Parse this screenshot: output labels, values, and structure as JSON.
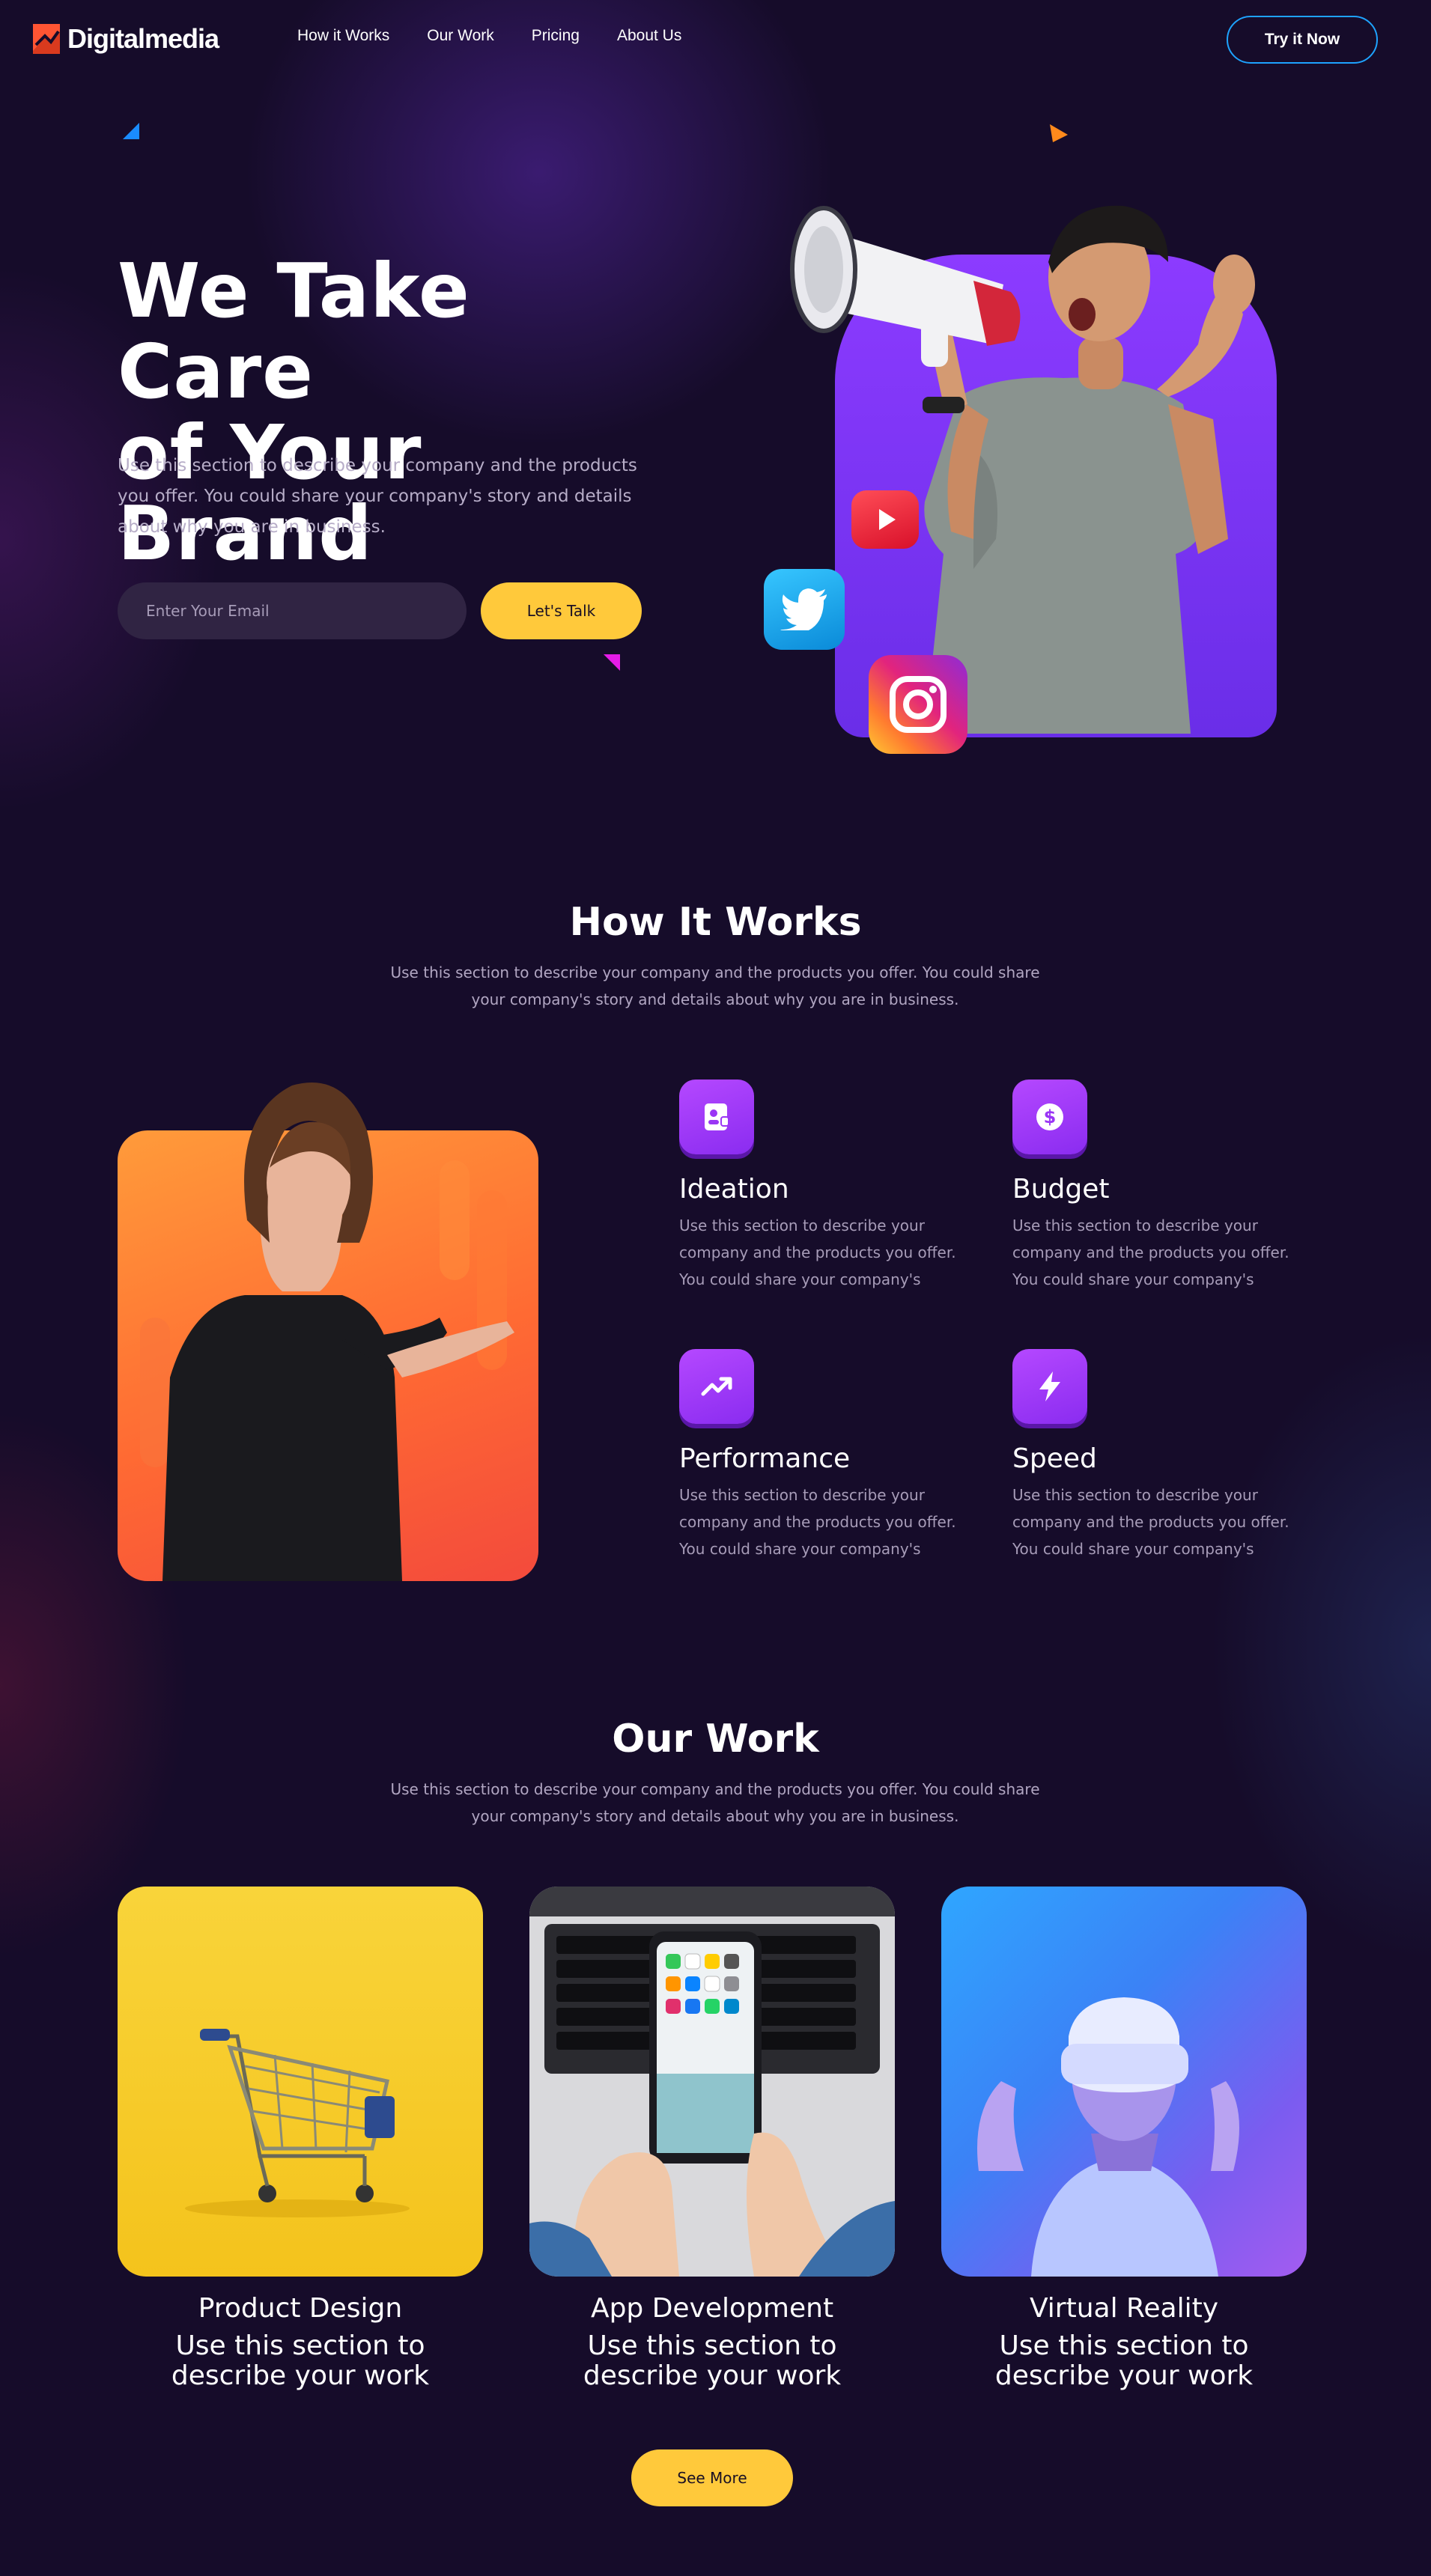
{
  "nav": {
    "logo_text": "Digitalmedia",
    "links": [
      "How it Works",
      "Our Work",
      "Pricing",
      "About Us"
    ],
    "cta": "Try it Now"
  },
  "hero": {
    "title_line1": "We Take Care",
    "title_line2": "of Your Brand",
    "description": "Use this section to describe your company and the products you offer. You could share your company's story and details about why you are in business.",
    "email_placeholder": "Enter Your Email",
    "cta": "Let's Talk"
  },
  "how": {
    "title": "How It Works",
    "subtitle": "Use this section to describe your company and the products you offer. You could share your company's story and details about why you are in business.",
    "features": [
      {
        "title": "Ideation",
        "desc": "Use this section to describe your company and the products you offer. You could share your company's",
        "icon": "id-card-icon"
      },
      {
        "title": "Budget",
        "desc": "Use this section to describe your company and the products you offer. You could share your company's",
        "icon": "dollar-icon"
      },
      {
        "title": "Performance",
        "desc": "Use this section to describe your company and the products you offer. You could share your company's",
        "icon": "trending-up-icon"
      },
      {
        "title": "Speed",
        "desc": "Use this section to describe your company and the products you offer. You could share your company's",
        "icon": "lightning-icon"
      }
    ]
  },
  "work": {
    "title": "Our Work",
    "subtitle": "Use this section to describe your company and the products you offer. You could share your company's story and details about why you are in business.",
    "items": [
      {
        "title": "Product Design",
        "desc": "Use this section to describe your work"
      },
      {
        "title": "App Development",
        "desc": "Use this section to describe your work"
      },
      {
        "title": "Virtual Reality",
        "desc": "Use this section to describe your work"
      }
    ],
    "cta": "See More"
  },
  "colors": {
    "background": "#160c2a",
    "accent_yellow": "#ffc93b",
    "accent_purple": "#8c3bff",
    "accent_blue": "#1ea3ff",
    "logo_red": "#ff5533"
  }
}
